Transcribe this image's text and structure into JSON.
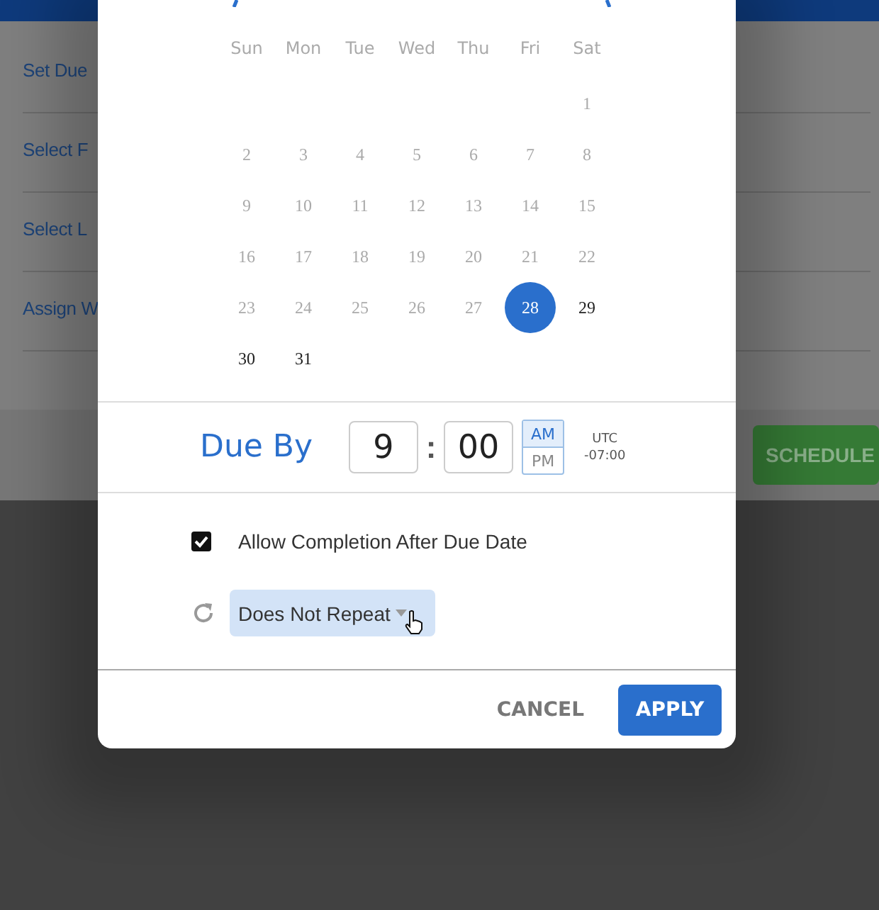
{
  "background_form": {
    "fields": [
      {
        "label": "Set Due"
      },
      {
        "label": "Select F"
      },
      {
        "label": "Select L"
      },
      {
        "label": "Assign W"
      }
    ],
    "buttons": [
      {
        "label": "SCHEDULE"
      }
    ]
  },
  "dialog": {
    "calendar": {
      "weekdays": [
        "Sun",
        "Mon",
        "Tue",
        "Wed",
        "Thu",
        "Fri",
        "Sat"
      ],
      "weeks": [
        {
          "kind": "leading",
          "days": [
            {
              "label": "1",
              "disabled": true,
              "selected": false
            }
          ]
        },
        {
          "kind": "regular",
          "days": [
            {
              "label": "2",
              "disabled": true,
              "selected": false
            },
            {
              "label": "3",
              "disabled": true,
              "selected": false
            },
            {
              "label": "4",
              "disabled": true,
              "selected": false
            },
            {
              "label": "5",
              "disabled": true,
              "selected": false
            },
            {
              "label": "6",
              "disabled": true,
              "selected": false
            },
            {
              "label": "7",
              "disabled": true,
              "selected": false
            },
            {
              "label": "8",
              "disabled": true,
              "selected": false
            }
          ]
        },
        {
          "kind": "regular",
          "days": [
            {
              "label": "9",
              "disabled": true,
              "selected": false
            },
            {
              "label": "10",
              "disabled": true,
              "selected": false
            },
            {
              "label": "11",
              "disabled": true,
              "selected": false
            },
            {
              "label": "12",
              "disabled": true,
              "selected": false
            },
            {
              "label": "13",
              "disabled": true,
              "selected": false
            },
            {
              "label": "14",
              "disabled": true,
              "selected": false
            },
            {
              "label": "15",
              "disabled": true,
              "selected": false
            }
          ]
        },
        {
          "kind": "regular",
          "days": [
            {
              "label": "16",
              "disabled": true,
              "selected": false
            },
            {
              "label": "17",
              "disabled": true,
              "selected": false
            },
            {
              "label": "18",
              "disabled": true,
              "selected": false
            },
            {
              "label": "19",
              "disabled": true,
              "selected": false
            },
            {
              "label": "20",
              "disabled": true,
              "selected": false
            },
            {
              "label": "21",
              "disabled": true,
              "selected": false
            },
            {
              "label": "22",
              "disabled": true,
              "selected": false
            }
          ]
        },
        {
          "kind": "regular",
          "days": [
            {
              "label": "23",
              "disabled": true,
              "selected": false
            },
            {
              "label": "24",
              "disabled": true,
              "selected": false
            },
            {
              "label": "25",
              "disabled": true,
              "selected": false
            },
            {
              "label": "26",
              "disabled": true,
              "selected": false
            },
            {
              "label": "27",
              "disabled": true,
              "selected": false
            },
            {
              "label": "28",
              "disabled": false,
              "selected": true
            },
            {
              "label": "29",
              "disabled": false,
              "selected": false
            }
          ]
        },
        {
          "kind": "regular",
          "days": [
            {
              "label": "30",
              "disabled": false,
              "selected": false
            },
            {
              "label": "31",
              "disabled": false,
              "selected": false
            }
          ]
        }
      ]
    },
    "due_by": {
      "label": "Due By",
      "hour": "9",
      "minute": "00",
      "separator": ":",
      "meridiem": [
        {
          "label": "AM",
          "selected": true
        },
        {
          "label": "PM",
          "selected": false
        }
      ],
      "timezone": [
        "UTC",
        "-07:00"
      ]
    },
    "allow_late": {
      "label": "Allow Completion After Due Date",
      "checked": true
    },
    "repeat": {
      "value": "Does Not Repeat"
    },
    "buttons": [
      {
        "label": "CANCEL",
        "kind": "text"
      },
      {
        "label": "APPLY",
        "kind": "primary"
      }
    ]
  }
}
